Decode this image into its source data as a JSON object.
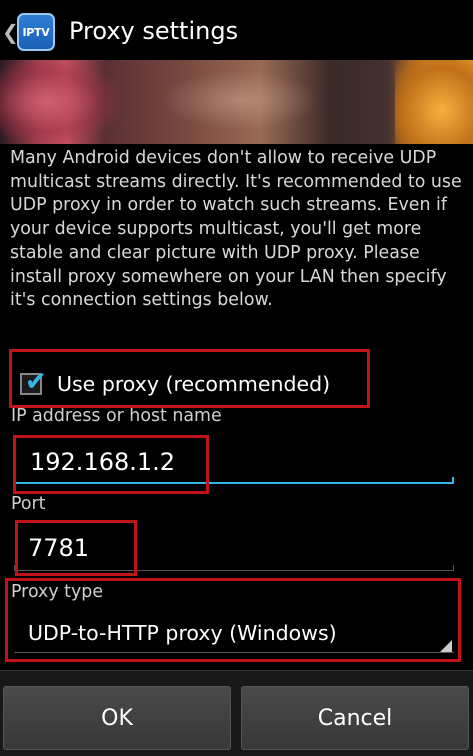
{
  "header": {
    "app_icon_text": "IPTV",
    "title": "Proxy settings"
  },
  "description": "Many Android devices don't allow to receive UDP multicast streams directly. It's recommended to use UDP proxy in order to watch such streams. Even if your device supports multicast, you'll get more stable and clear picture with UDP proxy. Please install proxy somewhere on your LAN then specify it's connection settings below.",
  "use_proxy": {
    "label": "Use proxy (recommended)",
    "checked": true
  },
  "host": {
    "label": "IP address or host name",
    "value": "192.168.1.2"
  },
  "port": {
    "label": "Port",
    "value": "7781"
  },
  "proxy_type": {
    "label": "Proxy type",
    "value": "UDP-to-HTTP proxy (Windows)"
  },
  "buttons": {
    "ok": "OK",
    "cancel": "Cancel"
  },
  "colors": {
    "accent": "#33b5e5",
    "highlight": "#c0141a"
  },
  "icons": {
    "back": "chevron-left-icon",
    "app": "iptv-app-icon",
    "check": "checkmark-icon",
    "dropdown": "dropdown-corner-icon"
  }
}
